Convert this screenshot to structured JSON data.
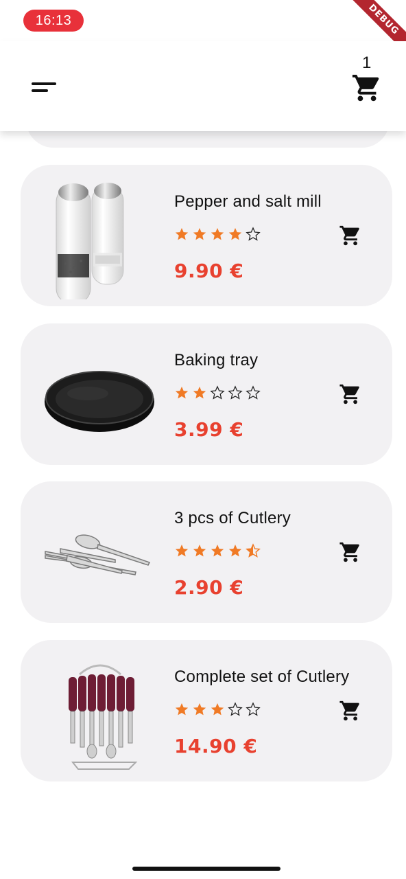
{
  "status_bar": {
    "time": "16:13",
    "debug_label": "DEBUG"
  },
  "app_bar": {
    "cart_count": "1",
    "icons": [
      "menu-icon",
      "cart-icon"
    ]
  },
  "products": [
    {
      "name": "Pepper and salt mill",
      "rating": 4,
      "price": "9.90 €",
      "image": "pepper-salt-mill"
    },
    {
      "name": "Baking tray",
      "rating": 2,
      "price": "3.99 €",
      "image": "baking-tray"
    },
    {
      "name": "3 pcs of Cutlery",
      "rating": 4.5,
      "price": "2.90 €",
      "image": "cutlery"
    },
    {
      "name": "Complete set of Cutlery",
      "rating": 3,
      "price": "14.90 €",
      "image": "cutlery-set"
    }
  ],
  "colors": {
    "accent": "#e8412f",
    "star": "#f07a25",
    "card_bg": "#f2f1f3",
    "time_pill": "#e8313a"
  }
}
